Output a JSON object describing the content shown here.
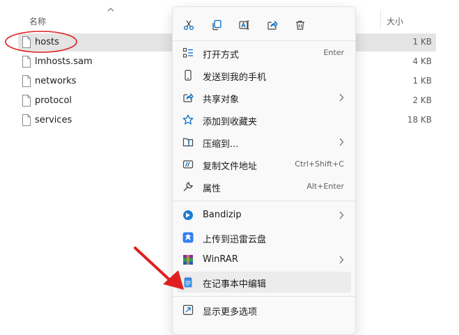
{
  "explorer": {
    "columns": {
      "name": "名称",
      "size": "大小"
    },
    "files": [
      {
        "name": "hosts",
        "size": "1 KB",
        "selected": true
      },
      {
        "name": "lmhosts.sam",
        "size": "4 KB"
      },
      {
        "name": "networks",
        "size": "1 KB"
      },
      {
        "name": "protocol",
        "size": "2 KB"
      },
      {
        "name": "services",
        "size": "18 KB"
      }
    ]
  },
  "context_menu": {
    "quick_actions": [
      "scissors-icon",
      "copy-icon",
      "rename-icon",
      "share-icon",
      "trash-icon"
    ],
    "items": [
      {
        "label": "打开方式",
        "shortcut": "Enter",
        "icon": "open-with-icon"
      },
      {
        "label": "发送到我的手机",
        "icon": "phone-icon"
      },
      {
        "label": "共享对象",
        "submenu": true,
        "icon": "share-icon"
      },
      {
        "label": "添加到收藏夹",
        "icon": "star-icon"
      },
      {
        "label": "压缩到...",
        "submenu": true,
        "icon": "zip-icon"
      },
      {
        "label": "复制文件地址",
        "shortcut": "Ctrl+Shift+C",
        "icon": "copy-path-icon"
      },
      {
        "label": "属性",
        "shortcut": "Alt+Enter",
        "icon": "wrench-icon"
      },
      {
        "label": "Bandizip",
        "submenu": true,
        "icon": "bandizip-icon"
      },
      {
        "label": "上传到迅雷云盘",
        "icon": "thunder-icon"
      },
      {
        "label": "WinRAR",
        "submenu": true,
        "icon": "winrar-icon"
      },
      {
        "label": "在记事本中编辑",
        "icon": "notepad-icon"
      },
      {
        "label": "显示更多选项",
        "icon": "more-options-icon"
      }
    ]
  },
  "colors": {
    "accent": "#0067c0",
    "annotation_red": "#e02020",
    "selection": "#e4e4e4"
  }
}
